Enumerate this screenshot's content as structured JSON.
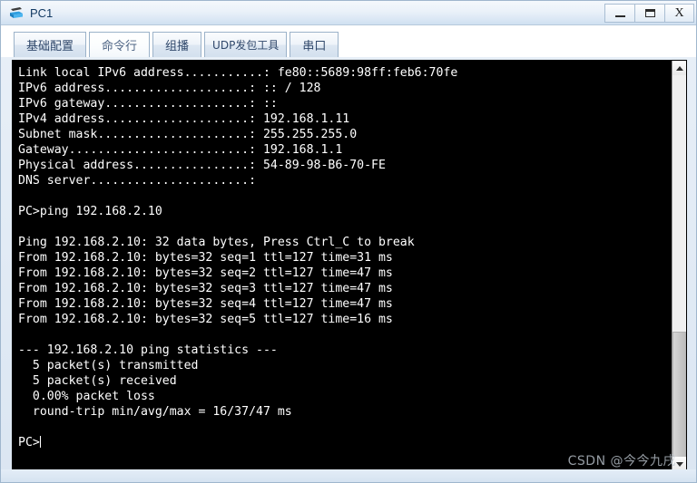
{
  "window": {
    "title": "PC1",
    "icon": "pc-device-icon",
    "buttons": [
      {
        "name": "minimize-button",
        "label": "—",
        "icon": "minimize-icon"
      },
      {
        "name": "maximize-button",
        "label": "□",
        "icon": "maximize-icon"
      },
      {
        "name": "close-button",
        "label": "X",
        "icon": "close-icon"
      }
    ]
  },
  "tabs": [
    {
      "label": "基础配置",
      "name": "tab-basic-config",
      "active": false
    },
    {
      "label": "命令行",
      "name": "tab-command-line",
      "active": true
    },
    {
      "label": "组播",
      "name": "tab-multicast",
      "active": false
    },
    {
      "label": "UDP发包工具",
      "name": "tab-udp-tool",
      "active": false
    },
    {
      "label": "串口",
      "name": "tab-serial-port",
      "active": false
    }
  ],
  "terminal": {
    "background": "#000000",
    "foreground": "#ffffff",
    "lines": [
      "Link local IPv6 address...........: fe80::5689:98ff:feb6:70fe",
      "IPv6 address....................: :: / 128",
      "IPv6 gateway....................: ::",
      "IPv4 address....................: 192.168.1.11",
      "Subnet mask.....................: 255.255.255.0",
      "Gateway.........................: 192.168.1.1",
      "Physical address................: 54-89-98-B6-70-FE",
      "DNS server......................:",
      "",
      "PC>ping 192.168.2.10",
      "",
      "Ping 192.168.2.10: 32 data bytes, Press Ctrl_C to break",
      "From 192.168.2.10: bytes=32 seq=1 ttl=127 time=31 ms",
      "From 192.168.2.10: bytes=32 seq=2 ttl=127 time=47 ms",
      "From 192.168.2.10: bytes=32 seq=3 ttl=127 time=47 ms",
      "From 192.168.2.10: bytes=32 seq=4 ttl=127 time=47 ms",
      "From 192.168.2.10: bytes=32 seq=5 ttl=127 time=16 ms",
      "",
      "--- 192.168.2.10 ping statistics ---",
      "  5 packet(s) transmitted",
      "  5 packet(s) received",
      "  0.00% packet loss",
      "  round-trip min/avg/max = 16/37/47 ms",
      ""
    ],
    "prompt": "PC>"
  },
  "scrollbar": {
    "up_arrow": "scroll-up-icon",
    "down_arrow": "scroll-down-icon"
  },
  "watermark": "CSDN @今今九戌"
}
